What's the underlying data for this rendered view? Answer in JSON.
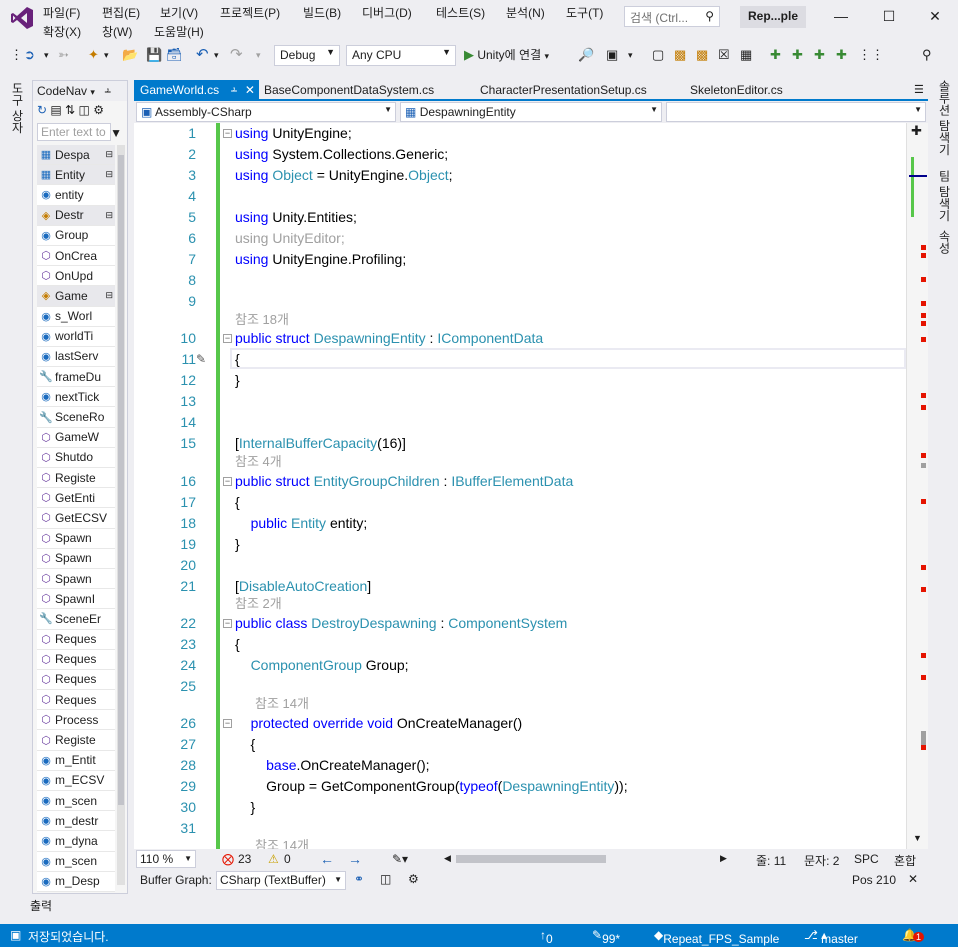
{
  "menu": {
    "row1": [
      "파일(F)",
      "편집(E)",
      "보기(V)",
      "프로젝트(P)",
      "빌드(B)",
      "디버그(D)",
      "테스트(S)",
      "분석(N)",
      "도구(T)"
    ],
    "row2": [
      "확장(X)",
      "창(W)",
      "도움말(H)"
    ],
    "search_placeholder": "검색 (Ctrl...",
    "project_title": "Rep...ple"
  },
  "toolbar": {
    "config": "Debug",
    "platform": "Any CPU",
    "attach": "Unity에 연결"
  },
  "left_strip": {
    "label": "도구 상자"
  },
  "right_strip": {
    "labels": [
      "솔루션 탐색기",
      "팀 탐색기",
      "속성"
    ]
  },
  "codenav": {
    "title": "CodeNav",
    "filter_placeholder": "Enter text to",
    "items": [
      {
        "icon": "struct-icon",
        "label": "Despa",
        "header": true
      },
      {
        "icon": "struct-icon",
        "label": "Entity",
        "header": true
      },
      {
        "icon": "field-icon",
        "label": "entity"
      },
      {
        "icon": "class-icon",
        "label": "Destr",
        "header": true
      },
      {
        "icon": "field-icon",
        "label": "Group"
      },
      {
        "icon": "method-icon",
        "label": "OnCrea"
      },
      {
        "icon": "method-icon",
        "label": "OnUpd"
      },
      {
        "icon": "class-icon",
        "label": "Game",
        "header": true
      },
      {
        "icon": "field-icon",
        "label": "s_Worl"
      },
      {
        "icon": "field-icon",
        "label": "worldTi"
      },
      {
        "icon": "field-icon",
        "label": "lastServ"
      },
      {
        "icon": "property-icon",
        "label": "frameDu"
      },
      {
        "icon": "field-icon",
        "label": "nextTick"
      },
      {
        "icon": "property-icon",
        "label": "SceneRo"
      },
      {
        "icon": "constructor-icon",
        "label": "GameW"
      },
      {
        "icon": "method-icon",
        "label": "Shutdo"
      },
      {
        "icon": "method-icon",
        "label": "Registe"
      },
      {
        "icon": "method-icon",
        "label": "GetEnti"
      },
      {
        "icon": "method-icon",
        "label": "GetECSV"
      },
      {
        "icon": "method-icon",
        "label": "Spawn"
      },
      {
        "icon": "method-icon",
        "label": "Spawn"
      },
      {
        "icon": "method-icon",
        "label": "Spawn"
      },
      {
        "icon": "method-icon",
        "label": "SpawnI"
      },
      {
        "icon": "property-icon",
        "label": "SceneEr"
      },
      {
        "icon": "method-icon",
        "label": "Reques"
      },
      {
        "icon": "method-icon",
        "label": "Reques"
      },
      {
        "icon": "method-icon",
        "label": "Reques"
      },
      {
        "icon": "method-icon",
        "label": "Reques"
      },
      {
        "icon": "method-icon",
        "label": "Process"
      },
      {
        "icon": "method-icon",
        "label": "Registe"
      },
      {
        "icon": "field-icon",
        "label": "m_Entit"
      },
      {
        "icon": "field-icon",
        "label": "m_ECSV"
      },
      {
        "icon": "field-icon",
        "label": "m_scen"
      },
      {
        "icon": "field-icon",
        "label": "m_destr"
      },
      {
        "icon": "field-icon",
        "label": "m_dyna"
      },
      {
        "icon": "field-icon",
        "label": "m_scen"
      },
      {
        "icon": "field-icon",
        "label": "m_Desp"
      }
    ]
  },
  "tabs": [
    {
      "label": "GameWorld.cs",
      "active": true
    },
    {
      "label": "BaseComponentDataSystem.cs",
      "active": false
    },
    {
      "label": "CharacterPresentationSetup.cs",
      "active": false
    },
    {
      "label": "SkeletonEditor.cs",
      "active": false
    }
  ],
  "navbar": {
    "project": "Assembly-CSharp",
    "type": "DespawningEntity",
    "member": ""
  },
  "code_lines": [
    {
      "n": "1",
      "html": "<span class=\"k\">using</span> UnityEngine;"
    },
    {
      "n": "2",
      "html": "<span class=\"k\">using</span> System.Collections.Generic;"
    },
    {
      "n": "3",
      "html": "<span class=\"k\">using</span> <span class=\"t\">Object</span> = UnityEngine.<span class=\"t\">Object</span>;"
    },
    {
      "n": "4",
      "html": ""
    },
    {
      "n": "5",
      "html": "<span class=\"k\">using</span> Unity.Entities;"
    },
    {
      "n": "6",
      "html": "<span class=\"g\">using UnityEditor;</span>"
    },
    {
      "n": "7",
      "html": "<span class=\"k\">using</span> UnityEngine.Profiling;"
    },
    {
      "n": "8",
      "html": ""
    },
    {
      "n": "9",
      "html": ""
    },
    {
      "n": "10",
      "html": "<span class=\"k\">public struct</span> <span class=\"t\">DespawningEntity</span> : <span class=\"t\">IComponentData</span>"
    },
    {
      "n": "11",
      "html": "{"
    },
    {
      "n": "12",
      "html": "}"
    },
    {
      "n": "13",
      "html": ""
    },
    {
      "n": "14",
      "html": ""
    },
    {
      "n": "15",
      "html": "[<span class=\"t\">InternalBufferCapacity</span>(16)]"
    },
    {
      "n": "16",
      "html": "<span class=\"k\">public struct</span> <span class=\"t\">EntityGroupChildren</span> : <span class=\"t\">IBufferElementData</span>"
    },
    {
      "n": "17",
      "html": "{"
    },
    {
      "n": "18",
      "html": "    <span class=\"k\">public</span> <span class=\"t\">Entity</span> entity;"
    },
    {
      "n": "19",
      "html": "}"
    },
    {
      "n": "20",
      "html": ""
    },
    {
      "n": "21",
      "html": "[<span class=\"t\">DisableAutoCreation</span>]"
    },
    {
      "n": "22",
      "html": "<span class=\"k\">public class</span> <span class=\"t\">DestroyDespawning</span> : <span class=\"t\">ComponentSystem</span>"
    },
    {
      "n": "23",
      "html": "{"
    },
    {
      "n": "24",
      "html": "    <span class=\"t\">ComponentGroup</span> Group;"
    },
    {
      "n": "25",
      "html": ""
    },
    {
      "n": "26",
      "html": "    <span class=\"k\">protected override void</span> OnCreateManager()"
    },
    {
      "n": "27",
      "html": "    {"
    },
    {
      "n": "28",
      "html": "        <span class=\"k\">base</span>.OnCreateManager();"
    },
    {
      "n": "29",
      "html": "        Group = GetComponentGroup(<span class=\"k\">typeof</span>(<span class=\"t\">DespawningEntity</span>));"
    },
    {
      "n": "30",
      "html": "    }"
    },
    {
      "n": "31",
      "html": ""
    }
  ],
  "lenses": [
    {
      "text": "참조 18개"
    },
    {
      "text": "참조 4개"
    },
    {
      "text": "참조 2개"
    },
    {
      "text": "참조 14개"
    },
    {
      "text": "참조 14개"
    }
  ],
  "editor_status": {
    "zoom": "110 %",
    "errors": "23",
    "warnings": "0",
    "line": "줄: 11",
    "col": "문자: 2",
    "spc": "SPC",
    "mixed": "혼합"
  },
  "buffer": {
    "label": "Buffer Graph:",
    "value": "CSharp (TextBuffer)",
    "pos": "Pos 210"
  },
  "output_tab": "출력",
  "statusbar": {
    "message": "저장되었습니다.",
    "up": "0",
    "pending": "99*",
    "repo": "Repeat_FPS_Sample",
    "branch": "master",
    "notifications": "1"
  },
  "colors": {
    "accent": "#007acc",
    "keyword": "#0000ff",
    "type": "#2b91af",
    "changed_margin": "#57c74a",
    "error_mark": "#e51400"
  }
}
